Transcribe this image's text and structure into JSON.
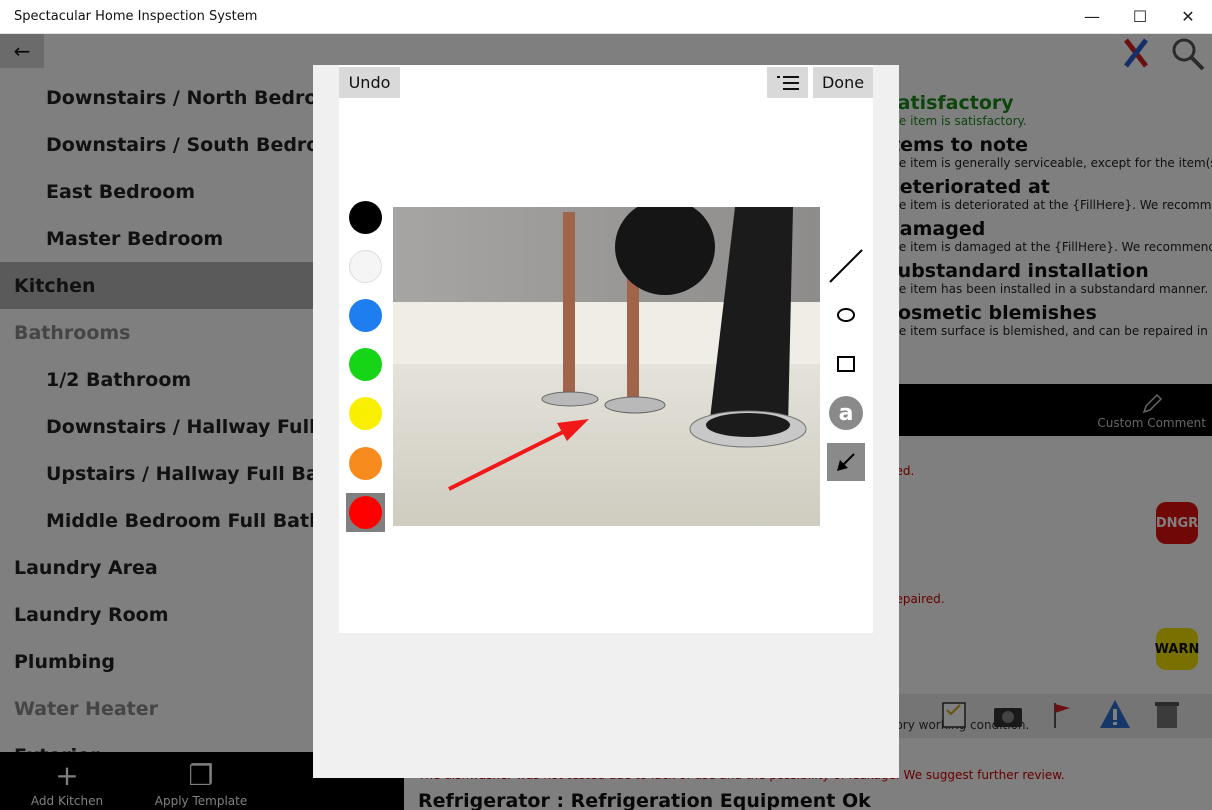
{
  "window": {
    "title": "Spectacular Home Inspection System",
    "minimize": "—",
    "maximize": "☐",
    "close": "✕"
  },
  "nav": {
    "back_icon": "←",
    "items": [
      {
        "label": "Downstairs / North Bedroom"
      },
      {
        "label": "Downstairs / South Bedroom"
      },
      {
        "label": "East Bedroom"
      },
      {
        "label": "Master Bedroom"
      },
      {
        "label": "Kitchen"
      },
      {
        "label": "Bathrooms"
      },
      {
        "label": "1/2 Bathroom"
      },
      {
        "label": "Downstairs / Hallway Full Bathroom"
      },
      {
        "label": "Upstairs / Hallway Full Bathroom"
      },
      {
        "label": "Middle Bedroom Full Bathroom"
      },
      {
        "label": "Laundry Area"
      },
      {
        "label": "Laundry Room"
      },
      {
        "label": "Plumbing"
      },
      {
        "label": "Water Heater"
      },
      {
        "label": "Exterior"
      }
    ],
    "bottom": {
      "add_label": "Add Kitchen",
      "add_icon": "+",
      "apply_label": "Apply Template",
      "apply_icon": "❐"
    }
  },
  "right": {
    "items": [
      {
        "title": "Satisfactory",
        "desc": "The item is satisfactory."
      },
      {
        "title": "Items to note",
        "desc": "The item is generally serviceable, except for the item(s) noted."
      },
      {
        "title": "Deteriorated at",
        "desc": "The item is deteriorated at the {FillHere}. We recommend repair or replacement."
      },
      {
        "title": "Damaged",
        "desc": "The item is damaged at the {FillHere}. We recommend repair or replacement."
      },
      {
        "title": "Substandard installation",
        "desc": "The item has been installed in a substandard manner. We recommend review."
      },
      {
        "title": "Cosmetic blemishes",
        "desc": "The item surface is blemished, and can be repaired in the course of normal maintenance."
      }
    ],
    "custom_comment": "Custom Comment",
    "red_note_1": "...ed.",
    "red_note_2": "...epaired.",
    "badge_danger": "DNGR",
    "badge_warn": "WARN",
    "row_note": "...ory working condition.",
    "bottom_note": "The dishwasher was not tested due to lack of use and the possibility of leakage. We suggest further review.",
    "bottom_title": "Refrigerator : Refrigeration Equipment Ok"
  },
  "dialog": {
    "undo_label": "Undo",
    "done_label": "Done",
    "menu_icon": "list-icon",
    "text_tool_label": "a",
    "colors": [
      "#000000",
      "#f5f5f5",
      "#1e7ef0",
      "#16d416",
      "#f8f000",
      "#f78b1e",
      "#ff0000"
    ],
    "selected_color_index": 6
  }
}
